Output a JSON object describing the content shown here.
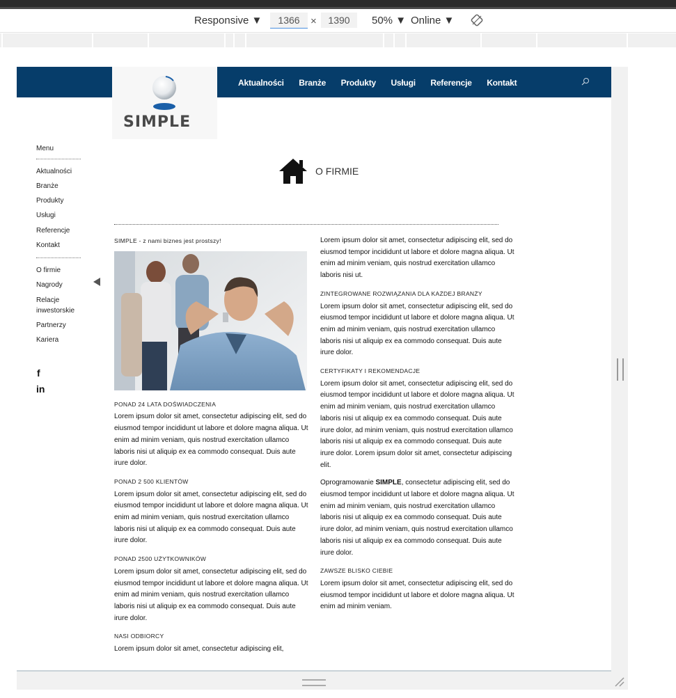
{
  "devtools": {
    "device": "Responsive ▼",
    "width": "1366",
    "times": "×",
    "height": "1390",
    "zoom": "50% ▼",
    "network": "Online ▼"
  },
  "site": {
    "logo_text": "SIMPLE",
    "nav": [
      "Aktualności",
      "Branże",
      "Produkty",
      "Usługi",
      "Referencje",
      "Kontakt"
    ],
    "side_menu_title": "Menu",
    "side_menu": [
      "Aktualności",
      "Branże",
      "Produkty",
      "Usługi",
      "Referencje",
      "Kontakt"
    ],
    "side_menu2": [
      "O  firmie",
      "Nagrody",
      "Relacje",
      "inwestorskie",
      "Partnerzy",
      "Kariera"
    ],
    "social": [
      "f",
      "in"
    ],
    "page_title": "O FIRMIE",
    "tagline": "SIMPLE - z nami biznes jest prostszy!",
    "left_sections": [
      {
        "title": "PONAD 24 LATA DOŚWIADCZENIA",
        "text": "Lorem ipsum dolor sit amet, consectetur adipiscing elit, sed do eiusmod tempor incididunt ut labore et dolore magna aliqua. Ut enim ad minim veniam, quis nostrud exercitation ullamco laboris nisi ut aliquip ex ea commodo consequat. Duis aute irure dolor."
      },
      {
        "title": "PONAD 2 500 KLIENTÓW",
        "text": "Lorem ipsum dolor sit amet, consectetur adipiscing elit, sed do eiusmod tempor incididunt ut labore et dolore magna aliqua. Ut enim ad minim veniam, quis nostrud exercitation ullamco laboris nisi ut aliquip ex ea commodo consequat. Duis aute irure dolor."
      },
      {
        "title": "PONAD 2500 UŻYTKOWNIKÓW",
        "text": "Lorem ipsum dolor sit amet, consectetur adipiscing elit, sed do eiusmod tempor incididunt ut labore et dolore magna aliqua. Ut enim ad minim veniam, quis nostrud exercitation ullamco laboris nisi ut aliquip ex ea commodo consequat. Duis aute irure dolor."
      },
      {
        "title": "NASI ODBIORCY",
        "text": "Lorem ipsum dolor sit amet, consectetur adipiscing elit,"
      }
    ],
    "right_intro": "Lorem ipsum dolor sit amet, consectetur adipiscing elit, sed do eiusmod tempor incididunt ut labore et dolore magna aliqua. Ut enim ad minim veniam, quis nostrud exercitation ullamco laboris nisi ut.",
    "right_sections": [
      {
        "title": "ZINTEGROWANE ROZWIĄZANIA DLA KAŻDEJ BRANŻY",
        "text": "Lorem ipsum dolor sit amet, consectetur adipiscing elit, sed do eiusmod tempor incididunt ut labore et dolore magna aliqua. Ut enim ad minim veniam, quis nostrud exercitation ullamco laboris nisi ut aliquip ex ea commodo consequat. Duis aute irure dolor."
      },
      {
        "title": "CERTYFIKATY I REKOMENDACJE",
        "text": "Lorem ipsum dolor sit amet, consectetur adipiscing elit, sed do eiusmod tempor incididunt ut labore et dolore magna aliqua. Ut enim ad minim veniam, quis nostrud exercitation ullamco laboris nisi ut aliquip ex ea commodo consequat. Duis aute irure dolor, ad minim veniam, quis nostrud exercitation ullamco laboris nisi ut aliquip ex ea commodo consequat. Duis aute irure dolor. Lorem ipsum dolor sit amet, consectetur adipiscing elit."
      }
    ],
    "software_bold": "SIMPLE",
    "software_prefix": "Oprogramowanie ",
    "software_text": ", consectetur adipiscing elit, sed do eiusmod tempor incididunt ut labore et dolore magna aliqua. Ut enim ad minim veniam, quis nostrud exercitation ullamco laboris nisi ut aliquip ex ea commodo consequat. Duis aute irure dolor, ad minim veniam, quis nostrud exercitation ullamco laboris nisi ut aliquip ex ea commodo consequat. Duis aute irure dolor.",
    "last_title": "ZAWSZE BLISKO CIEBIE",
    "last_text": "Lorem ipsum dolor sit amet, consectetur adipiscing elit, sed do eiusmod tempor incididunt ut labore et dolore magna aliqua. Ut enim ad minim veniam."
  },
  "colors": {
    "nav_bg": "#063d6a",
    "logo_blue": "#1a5fa8"
  },
  "icons": [
    "rotate-icon",
    "search-icon",
    "home-icon",
    "collapse-arrow-icon",
    "resize-handle-icon"
  ]
}
